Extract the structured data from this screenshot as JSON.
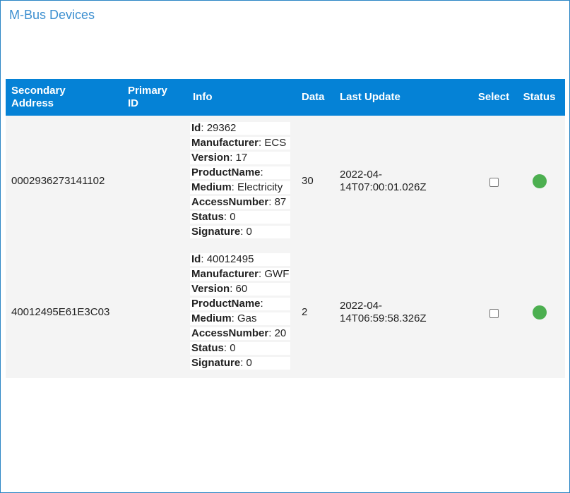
{
  "page": {
    "title": "M-Bus Devices"
  },
  "table": {
    "headers": {
      "secondary_line1": "Secondary",
      "secondary_line2": "Address",
      "primary_line1": "Primary",
      "primary_line2": "ID",
      "info": "Info",
      "data": "Data",
      "last_update": "Last Update",
      "select": "Select",
      "status": "Status"
    },
    "rows": [
      {
        "secondary_address": "0002936273141102",
        "primary_id": "",
        "info": {
          "id_label": "Id",
          "id": "29362",
          "manufacturer_label": "Manufacturer",
          "manufacturer": "ECS",
          "version_label": "Version",
          "version": "17",
          "productname_label": "ProductName",
          "productname": "",
          "medium_label": "Medium",
          "medium": "Electricity",
          "accessnumber_label": "AccessNumber",
          "accessnumber": "87",
          "status_label": "Status",
          "status": "0",
          "signature_label": "Signature",
          "signature": "0"
        },
        "data": "30",
        "last_update_line1": "2022-04-",
        "last_update_line2": "14T07:00:01.026Z",
        "selected": false,
        "status_color": "#4caf50"
      },
      {
        "secondary_address": "40012495E61E3C03",
        "primary_id": "",
        "info": {
          "id_label": "Id",
          "id": "40012495",
          "manufacturer_label": "Manufacturer",
          "manufacturer": "GWF",
          "version_label": "Version",
          "version": "60",
          "productname_label": "ProductName",
          "productname": "",
          "medium_label": "Medium",
          "medium": "Gas",
          "accessnumber_label": "AccessNumber",
          "accessnumber": "20",
          "status_label": "Status",
          "status": "0",
          "signature_label": "Signature",
          "signature": "0"
        },
        "data": "2",
        "last_update_line1": "2022-04-",
        "last_update_line2": "14T06:59:58.326Z",
        "selected": false,
        "status_color": "#4caf50"
      }
    ]
  },
  "colors": {
    "accent": "#0582d6",
    "title": "#3c8fd0",
    "row_background": "#f4f4f4",
    "status_ok": "#4caf50"
  }
}
